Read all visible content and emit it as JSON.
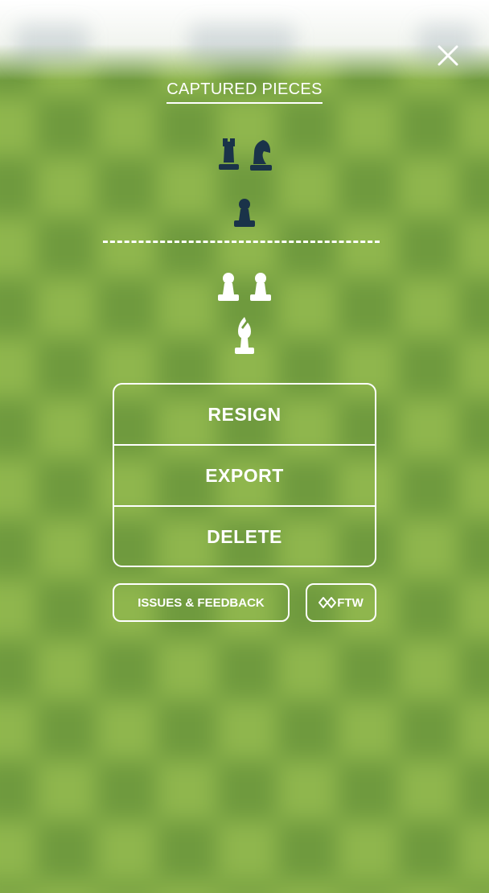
{
  "header": {
    "title": "CAPTURED PIECES"
  },
  "captured": {
    "opponent_row1": [
      "rook-black-icon",
      "knight-black-icon"
    ],
    "opponent_row2": [
      "pawn-black-icon"
    ],
    "player_row1": [
      "pawn-white-icon",
      "pawn-white-icon"
    ],
    "player_row2": [
      "bishop-white-icon"
    ]
  },
  "menu": {
    "resign_label": "RESIGN",
    "export_label": "EXPORT",
    "delete_label": "DELETE"
  },
  "footer": {
    "feedback_label": "ISSUES & FEEDBACK",
    "ftw_label": "FTW"
  },
  "colors": {
    "board_light": "#8fb64d",
    "board_dark": "#6f9a3e",
    "piece_dark": "#1a3349",
    "piece_light": "#ffffff"
  }
}
